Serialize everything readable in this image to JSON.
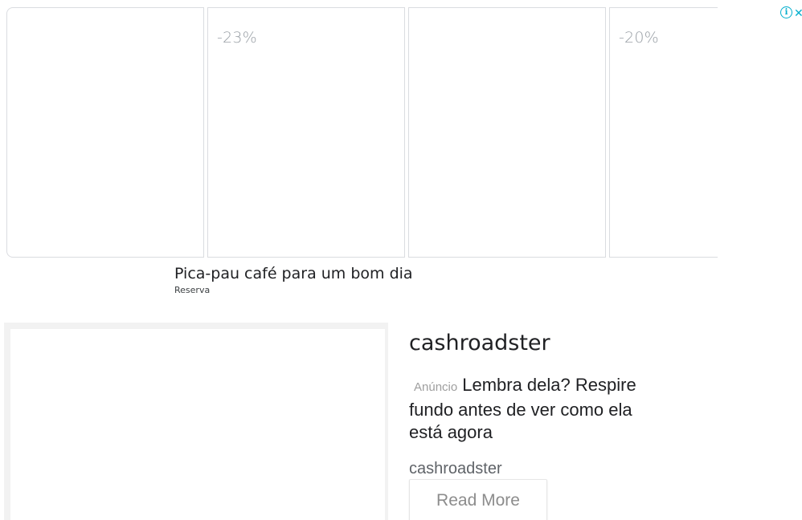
{
  "carousel": {
    "cards": [
      {
        "discount": ""
      },
      {
        "discount": "-23%"
      },
      {
        "discount": ""
      },
      {
        "discount": "-20%"
      }
    ],
    "controls": {
      "info_glyph": "i",
      "close_glyph": "✕"
    }
  },
  "caption": {
    "title": "Pica-pau café para um bom dia",
    "subtitle": "Reserva"
  },
  "native_ad": {
    "title": "cashroadster",
    "ad_label": "Anúncio",
    "headline": "Lembra dela? Respire fundo antes de ver como ela está agora",
    "source": "cashroadster",
    "cta_label": "Read More"
  },
  "colors": {
    "accent": "#00aecd",
    "card_border": "#dadce0",
    "muted_text": "#9aa0a6"
  }
}
